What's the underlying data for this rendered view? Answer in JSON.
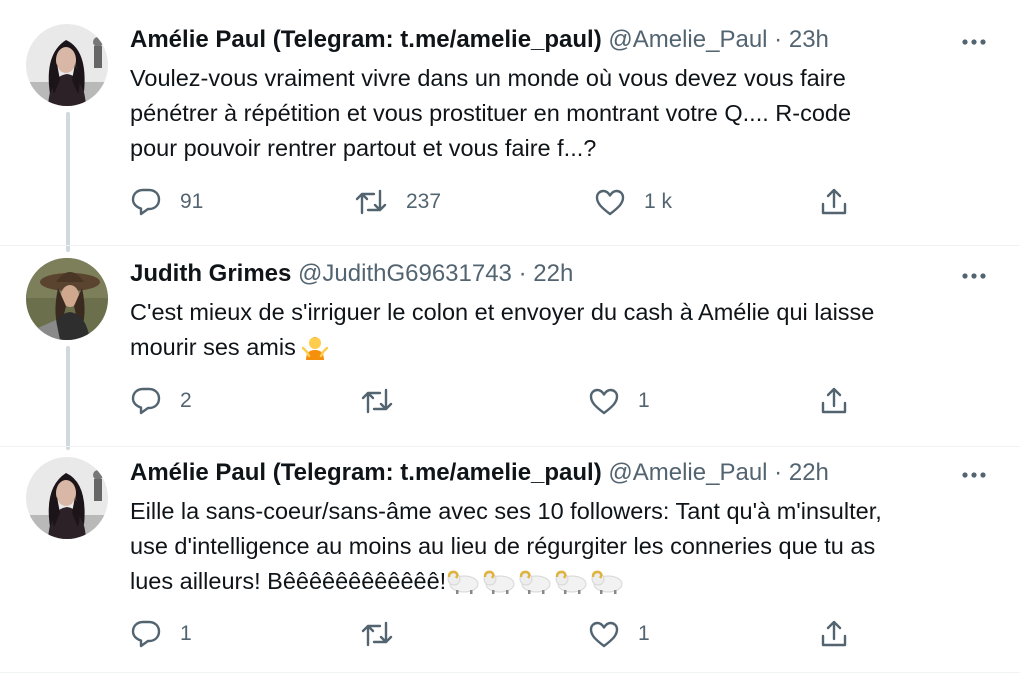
{
  "tweets": [
    {
      "name": "Amélie Paul (Telegram: t.me/amelie_paul)",
      "handle": "@Amelie_Paul",
      "dot": "·",
      "time": "23h",
      "text_lines": [
        "Voulez-vous vraiment vivre dans un monde où vous devez vous faire",
        "pénétrer à répétition et vous prostituer en montrant votre Q.... R-code",
        "pour pouvoir rentrer partout et vous faire f...?"
      ],
      "replies": "91",
      "retweets": "237",
      "likes": "1 k"
    },
    {
      "name": "Judith Grimes",
      "handle": "@JudithG69631743",
      "dot": "·",
      "time": "22h",
      "text_lines": [
        "C'est mieux de s'irriguer le colon et envoyer du cash à Amélie qui laisse",
        "mourir ses amis"
      ],
      "replies": "2",
      "retweets": "",
      "likes": "1"
    },
    {
      "name": "Amélie Paul (Telegram: t.me/amelie_paul)",
      "handle": "@Amelie_Paul",
      "dot": "·",
      "time": "22h",
      "text_lines": [
        "Eille la sans-coeur/sans-âme avec ses 10 followers: Tant qu'à m'insulter,",
        "use d'intelligence au moins au lieu de régurgiter les conneries que tu as",
        "lues ailleurs! Bêêêêêêêêêêêê!"
      ],
      "replies": "1",
      "retweets": "",
      "likes": "1"
    }
  ],
  "icons": {
    "more": "more-horizontal-icon",
    "reply": "reply-icon",
    "retweet": "retweet-icon",
    "like": "heart-icon",
    "share": "share-icon",
    "shrug": "person-shrugging-emoji",
    "ram": "ram-emoji"
  },
  "colors": {
    "text": "#0f1419",
    "secondary": "#536471",
    "thread_line": "#cfd9de",
    "divider": "#eff3f4"
  }
}
